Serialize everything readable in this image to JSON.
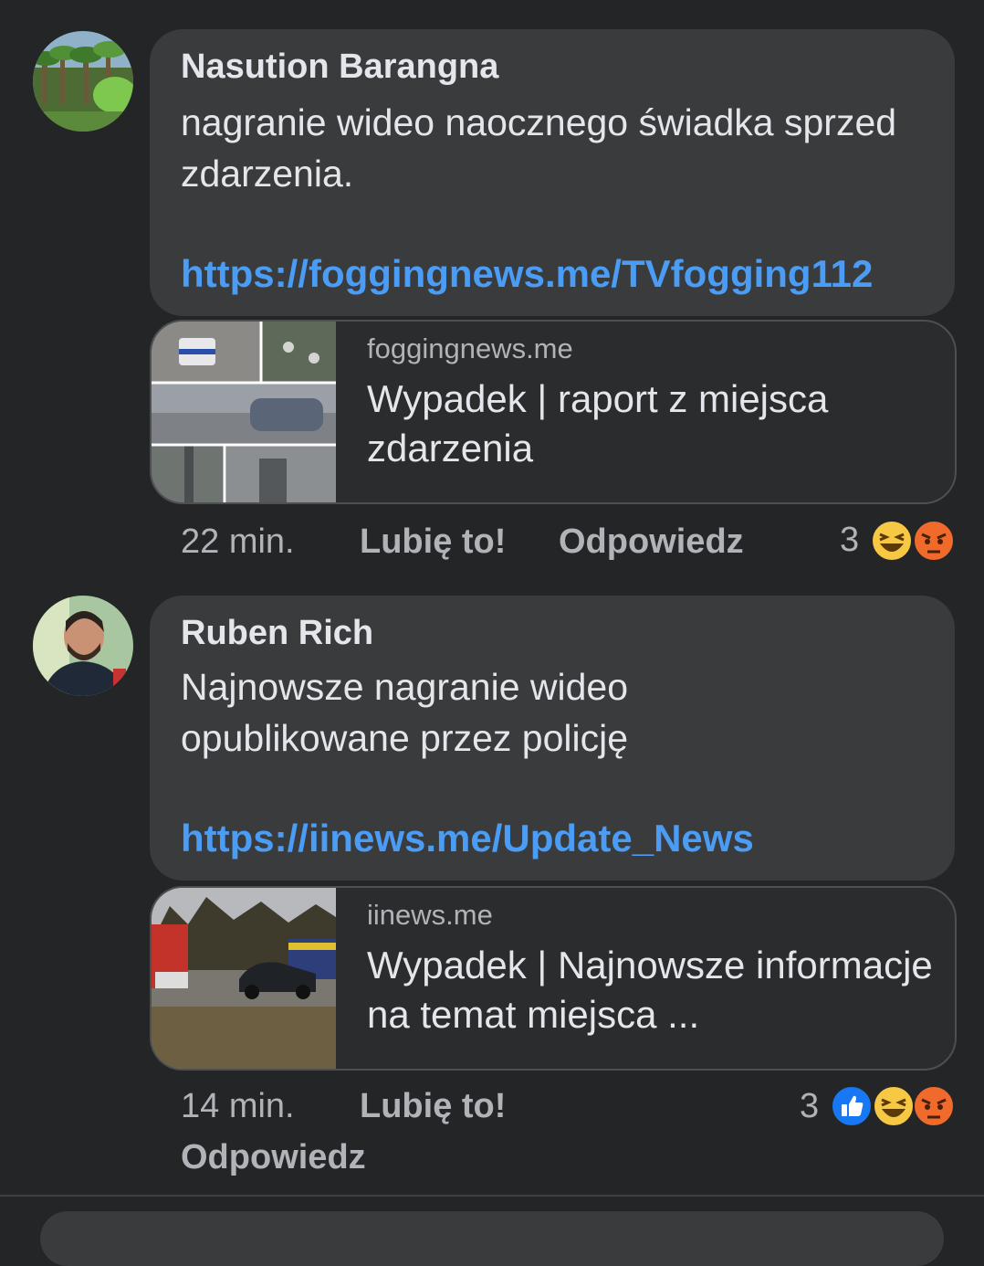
{
  "comments": [
    {
      "author": "Nasution Barangna",
      "text": "nagranie wideo naocznego świadka sprzed zdarzenia.",
      "link": "https://foggingnews.me/TVfogging112",
      "preview": {
        "domain": "foggingnews.me",
        "title": "Wypadek | raport z miejsca zdarzenia"
      },
      "time": "22 min.",
      "like_label": "Lubię to!",
      "reply_label": "Odpowiedz",
      "reaction_count": "3",
      "reactions": [
        "haha-icon",
        "angry-icon"
      ]
    },
    {
      "author": "Ruben Rich",
      "text": "Najnowsze nagranie wideo opublikowane przez policję",
      "link": "https://iinews.me/Update_News",
      "preview": {
        "domain": "iinews.me",
        "title": "Wypadek | Najnowsze informacje na temat miejsca ..."
      },
      "time": "14 min.",
      "like_label": "Lubię to!",
      "reply_label": "Odpowiedz",
      "reaction_count": "3",
      "reactions": [
        "like-icon",
        "haha-icon",
        "angry-icon"
      ]
    }
  ],
  "colors": {
    "background": "#242526",
    "bubble": "#3a3b3c",
    "link": "#4a9cf5",
    "secondary_text": "#b0b3b8"
  }
}
